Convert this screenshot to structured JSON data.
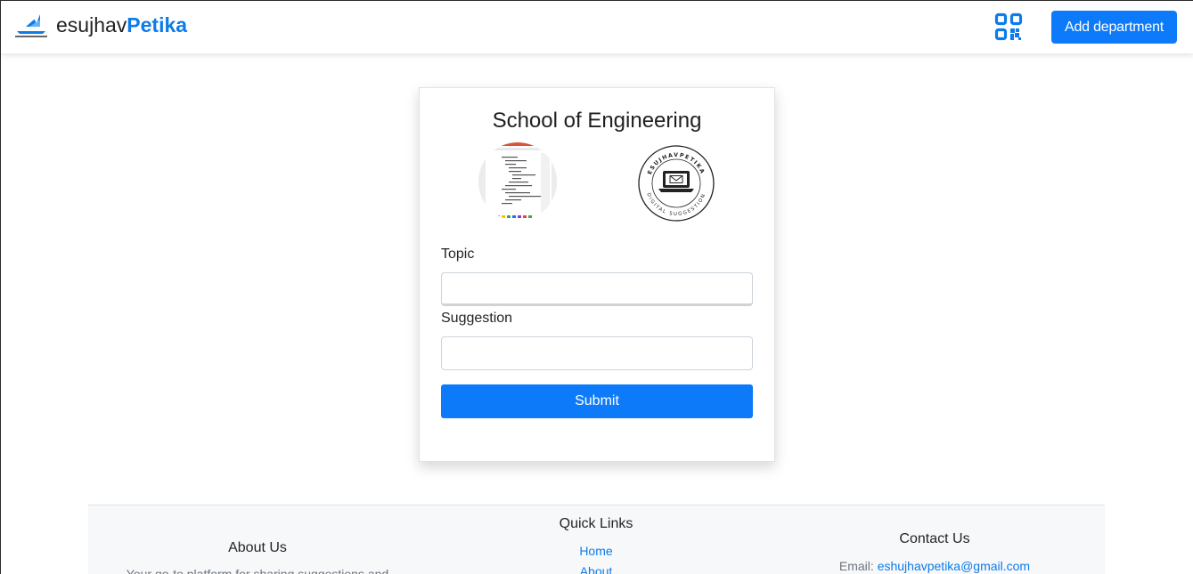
{
  "navbar": {
    "brand_prefix": "esujhav",
    "brand_accent": "Petika",
    "qr_icon": "qr-code-icon",
    "add_department_label": "Add department"
  },
  "form": {
    "title": "School of Engineering",
    "topic_label": "Topic",
    "topic_value": "",
    "suggestion_label": "Suggestion",
    "suggestion_value": "",
    "submit_label": "Submit"
  },
  "seal": {
    "top_text": "ESUJHAVPETIKA",
    "bottom_text": "DIGITAL SUGGESTION"
  },
  "footer": {
    "about": {
      "heading": "About Us",
      "text": "Your go-to platform for sharing suggestions and"
    },
    "quick_links": {
      "heading": "Quick Links",
      "items": [
        "Home",
        "About"
      ]
    },
    "contact": {
      "heading": "Contact Us",
      "email_label": "Email: ",
      "email": "eshujhavpetika@gmail.com"
    }
  },
  "colors": {
    "accent": "#0d7bf9",
    "brand_accent": "#0d7bea"
  }
}
